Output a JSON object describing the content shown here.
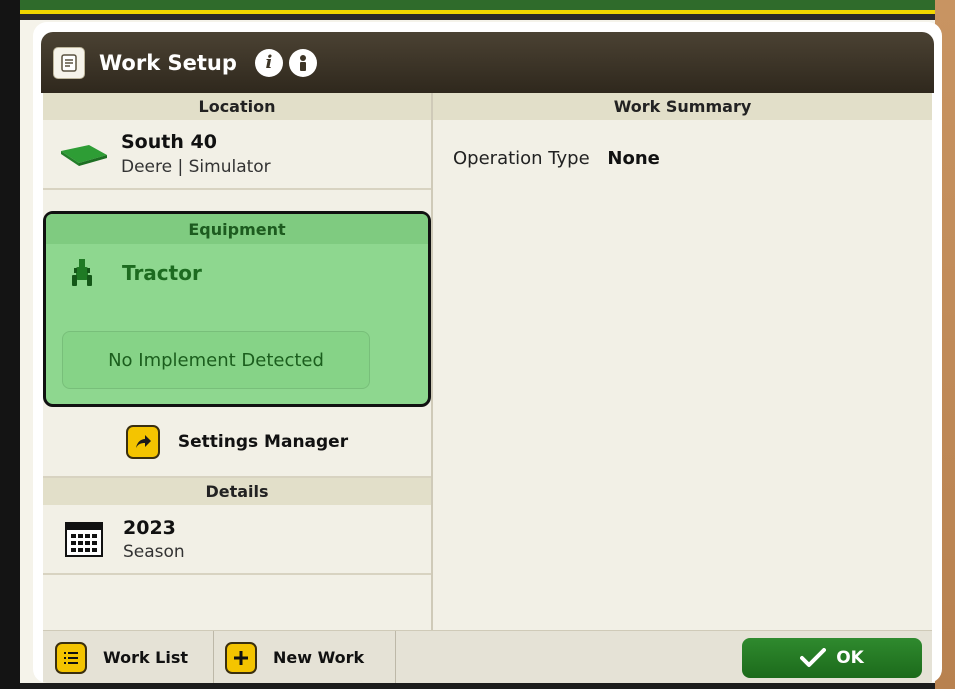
{
  "window": {
    "title": "Work Setup"
  },
  "location": {
    "header": "Location",
    "name": "South 40",
    "subtitle": "Deere | Simulator"
  },
  "equipment": {
    "header": "Equipment",
    "vehicle": "Tractor",
    "implement_status": "No Implement Detected"
  },
  "settings": {
    "label": "Settings Manager"
  },
  "details": {
    "header": "Details",
    "year": "2023",
    "label": "Season"
  },
  "work_summary": {
    "header": "Work Summary",
    "operation_type_label": "Operation Type",
    "operation_type_value": "None"
  },
  "footer": {
    "work_list": "Work List",
    "new_work": "New Work",
    "ok": "OK"
  },
  "colors": {
    "title_bar": "#3e3628",
    "equipment_highlight": "#8ed78f",
    "ok_button": "#2a7d29",
    "accent_yellow": "#f4c400"
  },
  "icons": [
    "app-notes-icon",
    "info-icon",
    "info-person-icon",
    "field-icon",
    "tractor-icon",
    "arrow-share-icon",
    "calendar-icon",
    "list-icon",
    "plus-icon",
    "checkmark-icon"
  ]
}
